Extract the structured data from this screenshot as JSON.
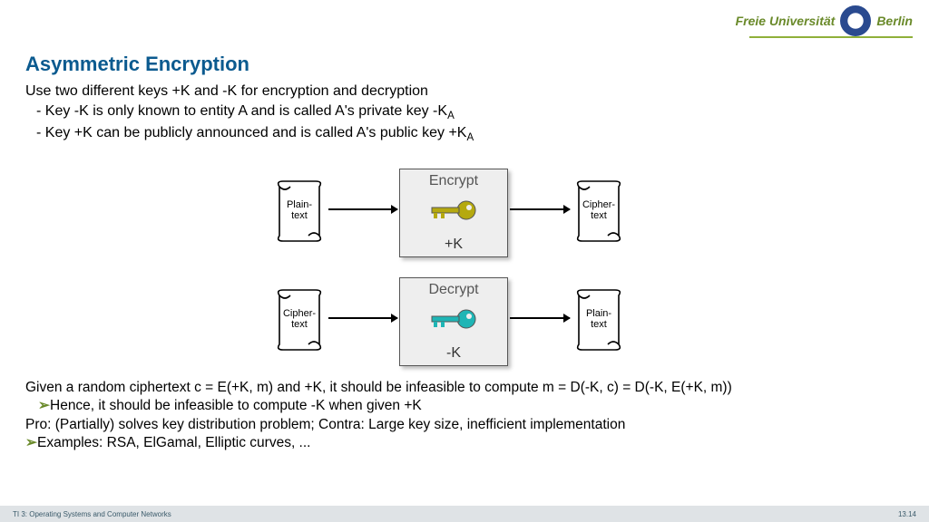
{
  "logo": {
    "left": "Freie Universität",
    "right": "Berlin"
  },
  "title": "Asymmetric Encryption",
  "intro": {
    "line1": "Use two different keys +K and -K for encryption and decryption",
    "bullet1_pre": "Key -K is only known to entity A and is called A's private key -K",
    "bullet1_sub": "A",
    "bullet2_pre": "Key +K can be publicly announced and is called A's public key +K",
    "bullet2_sub": "A"
  },
  "diagram": {
    "row1": {
      "left": "Plain-\ntext",
      "box_title": "Encrypt",
      "box_key": "+K",
      "right": "Cipher-\ntext",
      "key_color": "#b5a90f"
    },
    "row2": {
      "left": "Cipher-\ntext",
      "box_title": "Decrypt",
      "box_key": "-K",
      "right": "Plain-\ntext",
      "key_color": "#1fb5b5"
    }
  },
  "body2": {
    "l1": "Given a random ciphertext c = E(+K, m) and +K, it should be infeasible to compute m = D(-K, c) = D(-K, E(+K, m))",
    "l2": "Hence, it should be infeasible to compute -K when given +K",
    "l3": "Pro: (Partially) solves key distribution problem; Contra: Large key size, inefficient implementation",
    "l4": "Examples: RSA, ElGamal, Elliptic curves, ..."
  },
  "footer": {
    "left": "TI 3: Operating Systems and Computer Networks",
    "right": "13.14"
  }
}
